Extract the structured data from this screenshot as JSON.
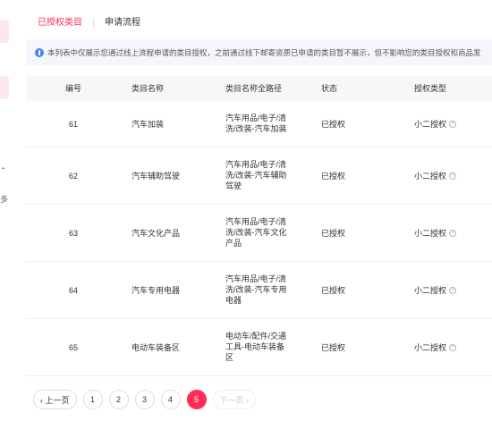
{
  "tabs": [
    {
      "label": "已授权类目"
    },
    {
      "label": "申请流程"
    }
  ],
  "notice": {
    "icon": "info-icon",
    "text": "本列表中仅展示您通过线上流程申请的类目授权，之前通过线下邮寄资质已申请的类目暂不展示，但不影响您的类目授权和商品发"
  },
  "sidebar": {
    "caret": "ˆ",
    "glyph": "多"
  },
  "table": {
    "headers": [
      "编号",
      "类目名称",
      "类目名称全路径",
      "状态",
      "授权类型"
    ],
    "rows": [
      {
        "id": "61",
        "name": "汽车加装",
        "path_lines": [
          "汽车用品/电子/清",
          "洗/改装-汽车加装"
        ],
        "status": "已授权",
        "auth": "小二授权"
      },
      {
        "id": "62",
        "name": "汽车辅助驾驶",
        "path_lines": [
          "汽车用品/电子/清",
          "洗/改装-汽车辅助",
          "驾驶"
        ],
        "status": "已授权",
        "auth": "小二授权"
      },
      {
        "id": "63",
        "name": "汽车文化产品",
        "path_lines": [
          "汽车用品/电子/清",
          "洗/改装-汽车文化",
          "产品"
        ],
        "status": "已授权",
        "auth": "小二授权"
      },
      {
        "id": "64",
        "name": "汽车专用电器",
        "path_lines": [
          "汽车用品/电子/清",
          "洗/改装-汽车专用",
          "电器"
        ],
        "status": "已授权",
        "auth": "小二授权"
      },
      {
        "id": "65",
        "name": "电动车装备区",
        "path_lines": [
          "电动车/配件/交通",
          "工具-电动车装备",
          "区"
        ],
        "status": "已授权",
        "auth": "小二授权"
      }
    ],
    "help_glyph": "?"
  },
  "pagination": {
    "prev_label": "‹ 上一页",
    "next_label": "下一页 ›",
    "pages": [
      "1",
      "2",
      "3",
      "4",
      "5"
    ],
    "current": "5"
  },
  "colors": {
    "accent": "#ff2d55",
    "notice_bg": "#f4f6fb",
    "info_icon": "#4b83f0",
    "header_bg": "#f7f7f7"
  }
}
